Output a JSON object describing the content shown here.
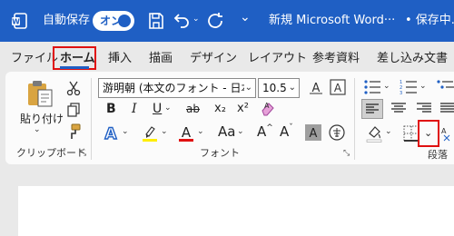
{
  "titlebar": {
    "autosave_label": "自動保存",
    "autosave_toggle": "オン",
    "document_title": "新規 Microsoft Word···",
    "save_status": "• 保存中..."
  },
  "tabs": [
    "ファイル",
    "ホーム",
    "挿入",
    "描画",
    "デザイン",
    "レイアウト",
    "参考資料",
    "差し込み文書"
  ],
  "ribbon": {
    "clipboard": {
      "paste_label": "貼り付け",
      "group_label": "クリップボード"
    },
    "font": {
      "font_name": "游明朝 (本文のフォント - 日本語)",
      "font_size": "10.5",
      "group_label": "フォント",
      "bold": "B",
      "italic": "I",
      "underline": "U",
      "strike": "ab",
      "subscript": "x₂",
      "superscript": "x²"
    },
    "paragraph": {
      "group_label": "段落"
    }
  },
  "colors": {
    "accent": "#1f5fc4",
    "highlight": "#ffee00",
    "font_color": "#e01010",
    "callout": "#e01010"
  }
}
